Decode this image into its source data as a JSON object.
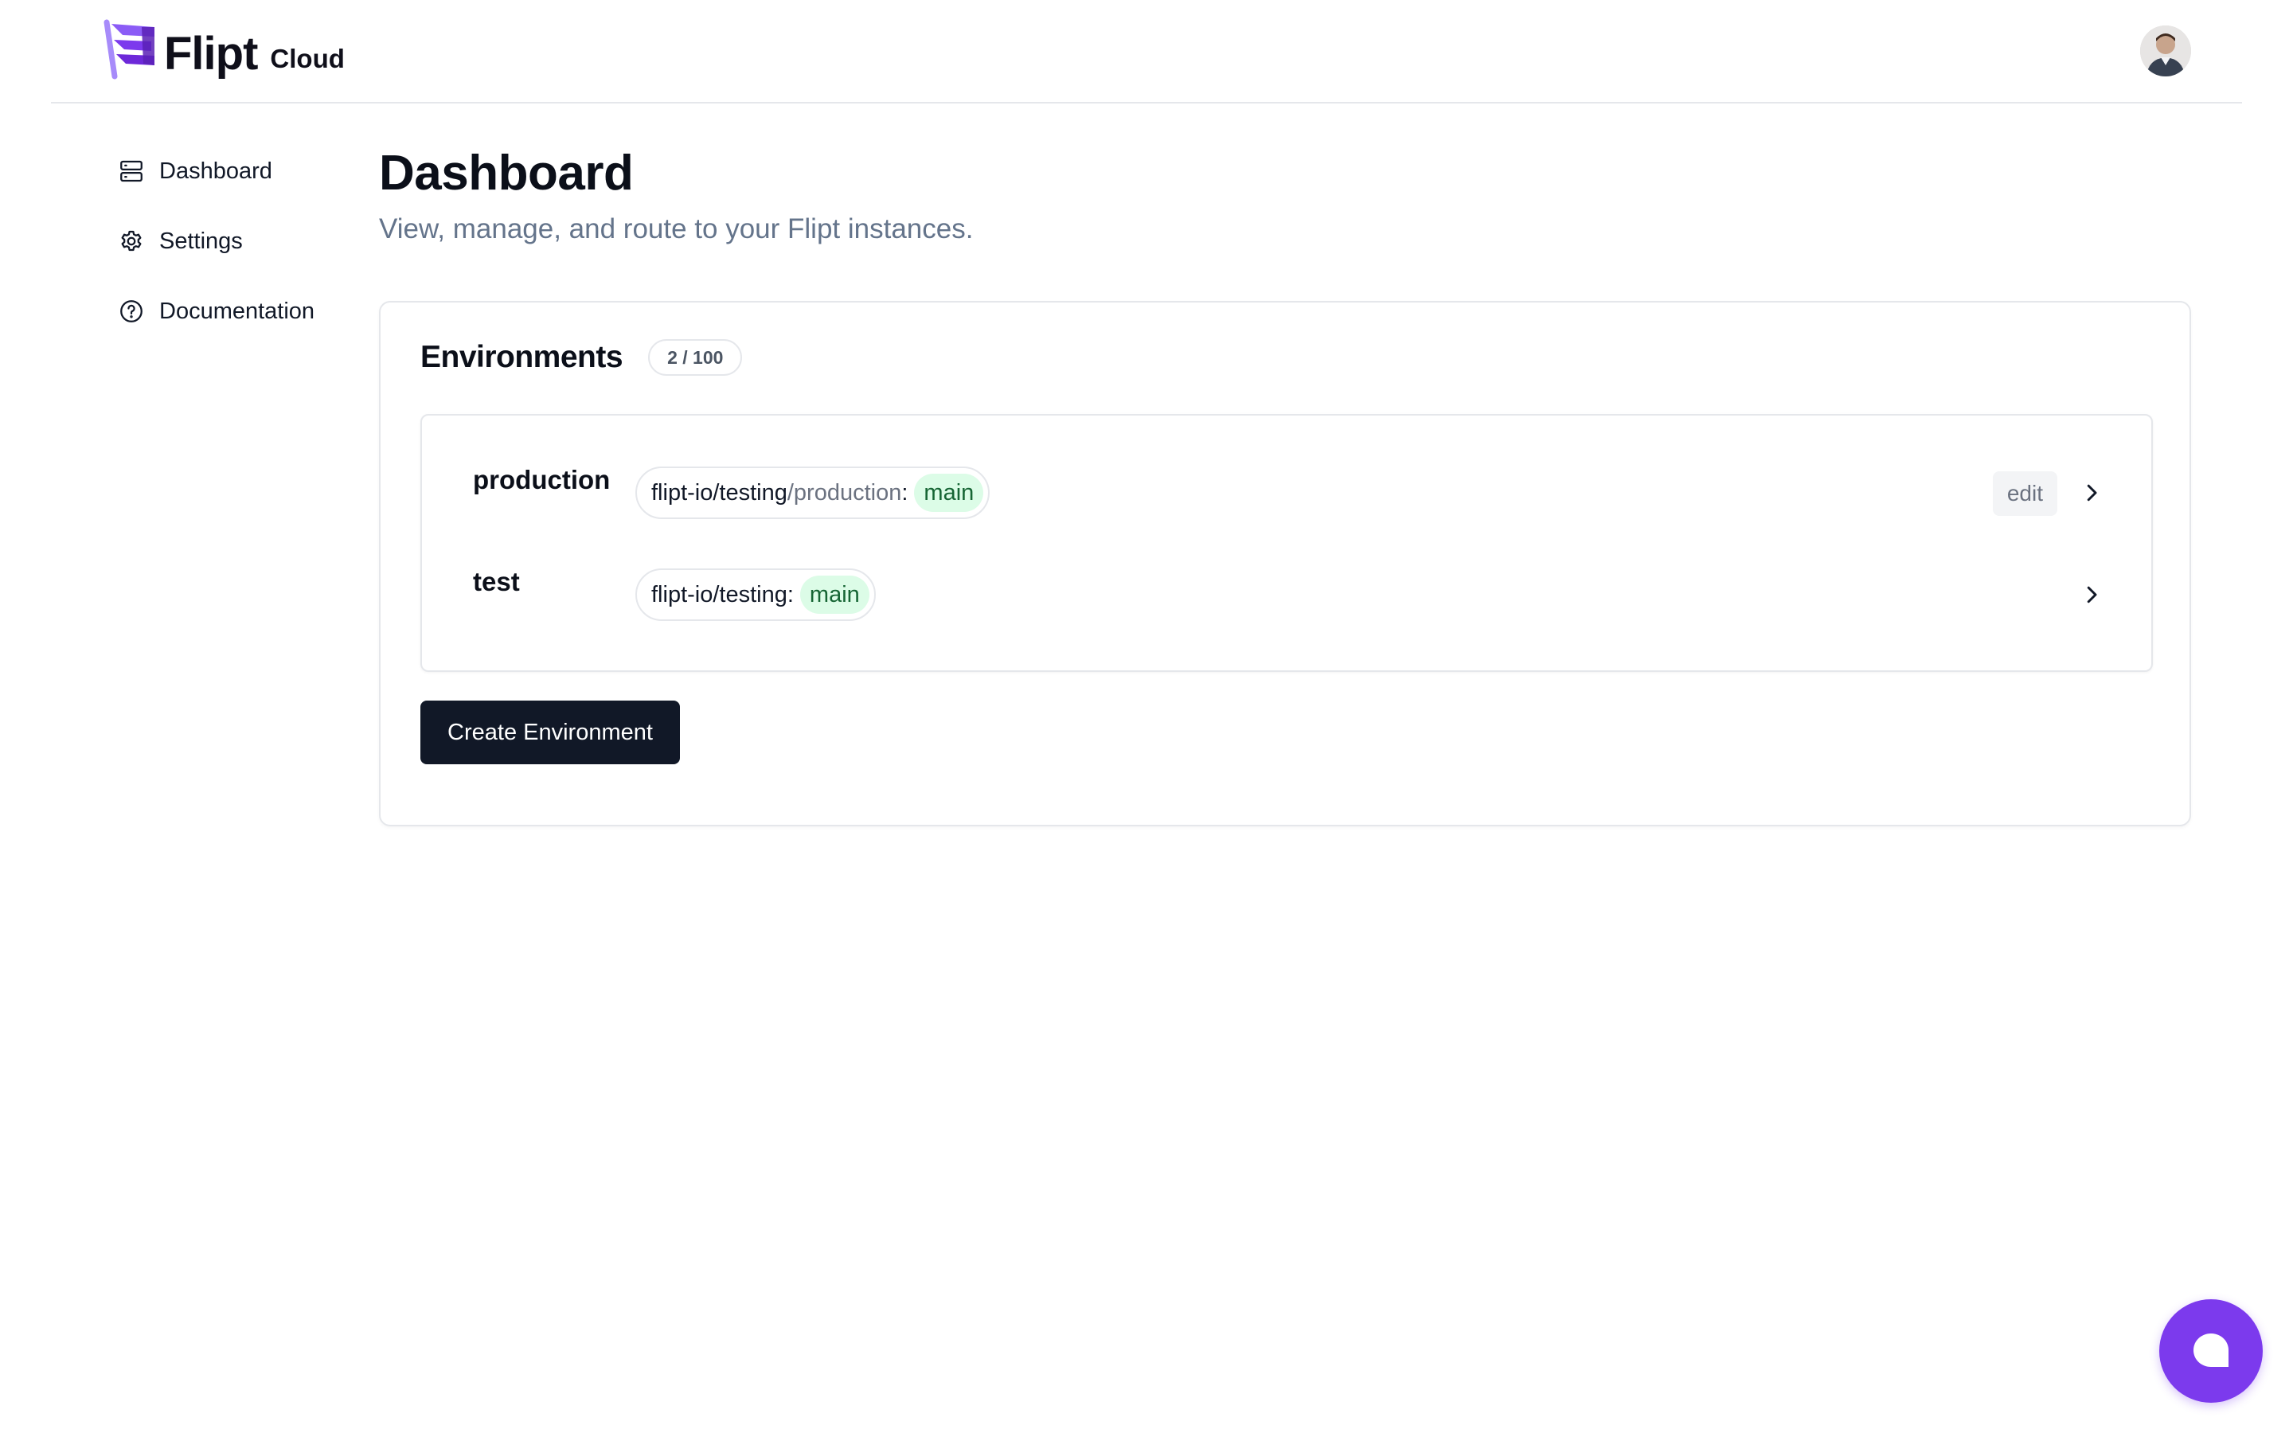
{
  "header": {
    "brand": "Flipt",
    "brand_suffix": "Cloud",
    "logo_icon": "flipt-flag-icon",
    "avatar_icon": "user-avatar"
  },
  "sidebar": {
    "items": [
      {
        "label": "Dashboard",
        "icon": "server-icon"
      },
      {
        "label": "Settings",
        "icon": "gear-icon"
      },
      {
        "label": "Documentation",
        "icon": "question-circle-icon"
      }
    ]
  },
  "main": {
    "title": "Dashboard",
    "subtitle": "View, manage, and route to your Flipt instances.",
    "environments": {
      "title": "Environments",
      "count": "2 / 100",
      "rows": [
        {
          "name": "production",
          "repo": "flipt-io/testing",
          "path": "/production",
          "separator": ":",
          "branch": "main",
          "edit_label": "edit"
        },
        {
          "name": "test",
          "repo": "flipt-io/testing",
          "path": "",
          "separator": ":",
          "branch": "main",
          "edit_label": ""
        }
      ],
      "create_label": "Create Environment"
    }
  },
  "chat": {
    "icon": "chat-bubble-icon"
  },
  "colors": {
    "accent": "#7c3aed",
    "primary_button": "#111827",
    "branch_bg": "#dcfce7",
    "branch_text": "#166534",
    "muted_text": "#64748b"
  }
}
